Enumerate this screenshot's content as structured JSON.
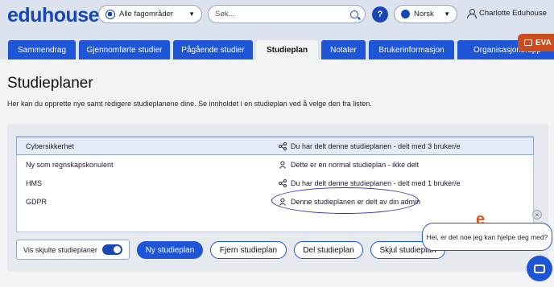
{
  "header": {
    "logo": "eduhouse",
    "category_select": "Alle fagområder",
    "search_placeholder": "Søk...",
    "help": "?",
    "language": "Norsk",
    "user": "Charlotte Eduhouse"
  },
  "tabs": [
    {
      "label": "Sammendrag"
    },
    {
      "label": "Gjennomførte studier"
    },
    {
      "label": "Pågående studier"
    },
    {
      "label": "Studieplan"
    },
    {
      "label": "Notater"
    },
    {
      "label": "Brukerinformasjon"
    },
    {
      "label": "Organisasjonsrapp"
    }
  ],
  "active_tab": "Studieplan",
  "eva_label": "EVA",
  "main": {
    "title": "Studieplaner",
    "intro": "Her kan du opprette nye samt redigere studieplanene dine. Se innholdet i en studieplan ved å velge den fra listen."
  },
  "plans": [
    {
      "name": "Cybersikkerhet",
      "status": "Du har delt denne studieplanen  - delt med 3 bruker/e",
      "icon": "share-icon"
    },
    {
      "name": "Ny som regnskapskonulent",
      "status": "Dette er en normal studieplan  - ikke delt",
      "icon": "user-icon"
    },
    {
      "name": "HMS",
      "status": "Du har delt denne studieplanen  - delt med 1 bruker/e",
      "icon": "share-icon"
    },
    {
      "name": "GDPR",
      "status": "Denne studieplanen er delt av din admin",
      "icon": "user-icon"
    }
  ],
  "controls": {
    "show_hidden_label": "Vis skjulte studieplaner",
    "show_hidden_on": true,
    "new_plan": "Ny studieplan",
    "remove_plan": "Fjern studieplan",
    "share_plan": "Del studieplan",
    "hide_plan": "Skjul studieplan"
  },
  "chat": {
    "logo": "e",
    "message": "Hei, er det noe jeg kan hjelpe deg med?",
    "close": "×"
  },
  "colors": {
    "brand_blue": "#1d55d6",
    "eva_orange": "#c94d1d",
    "highlight_circle": "#2f2fa8"
  }
}
